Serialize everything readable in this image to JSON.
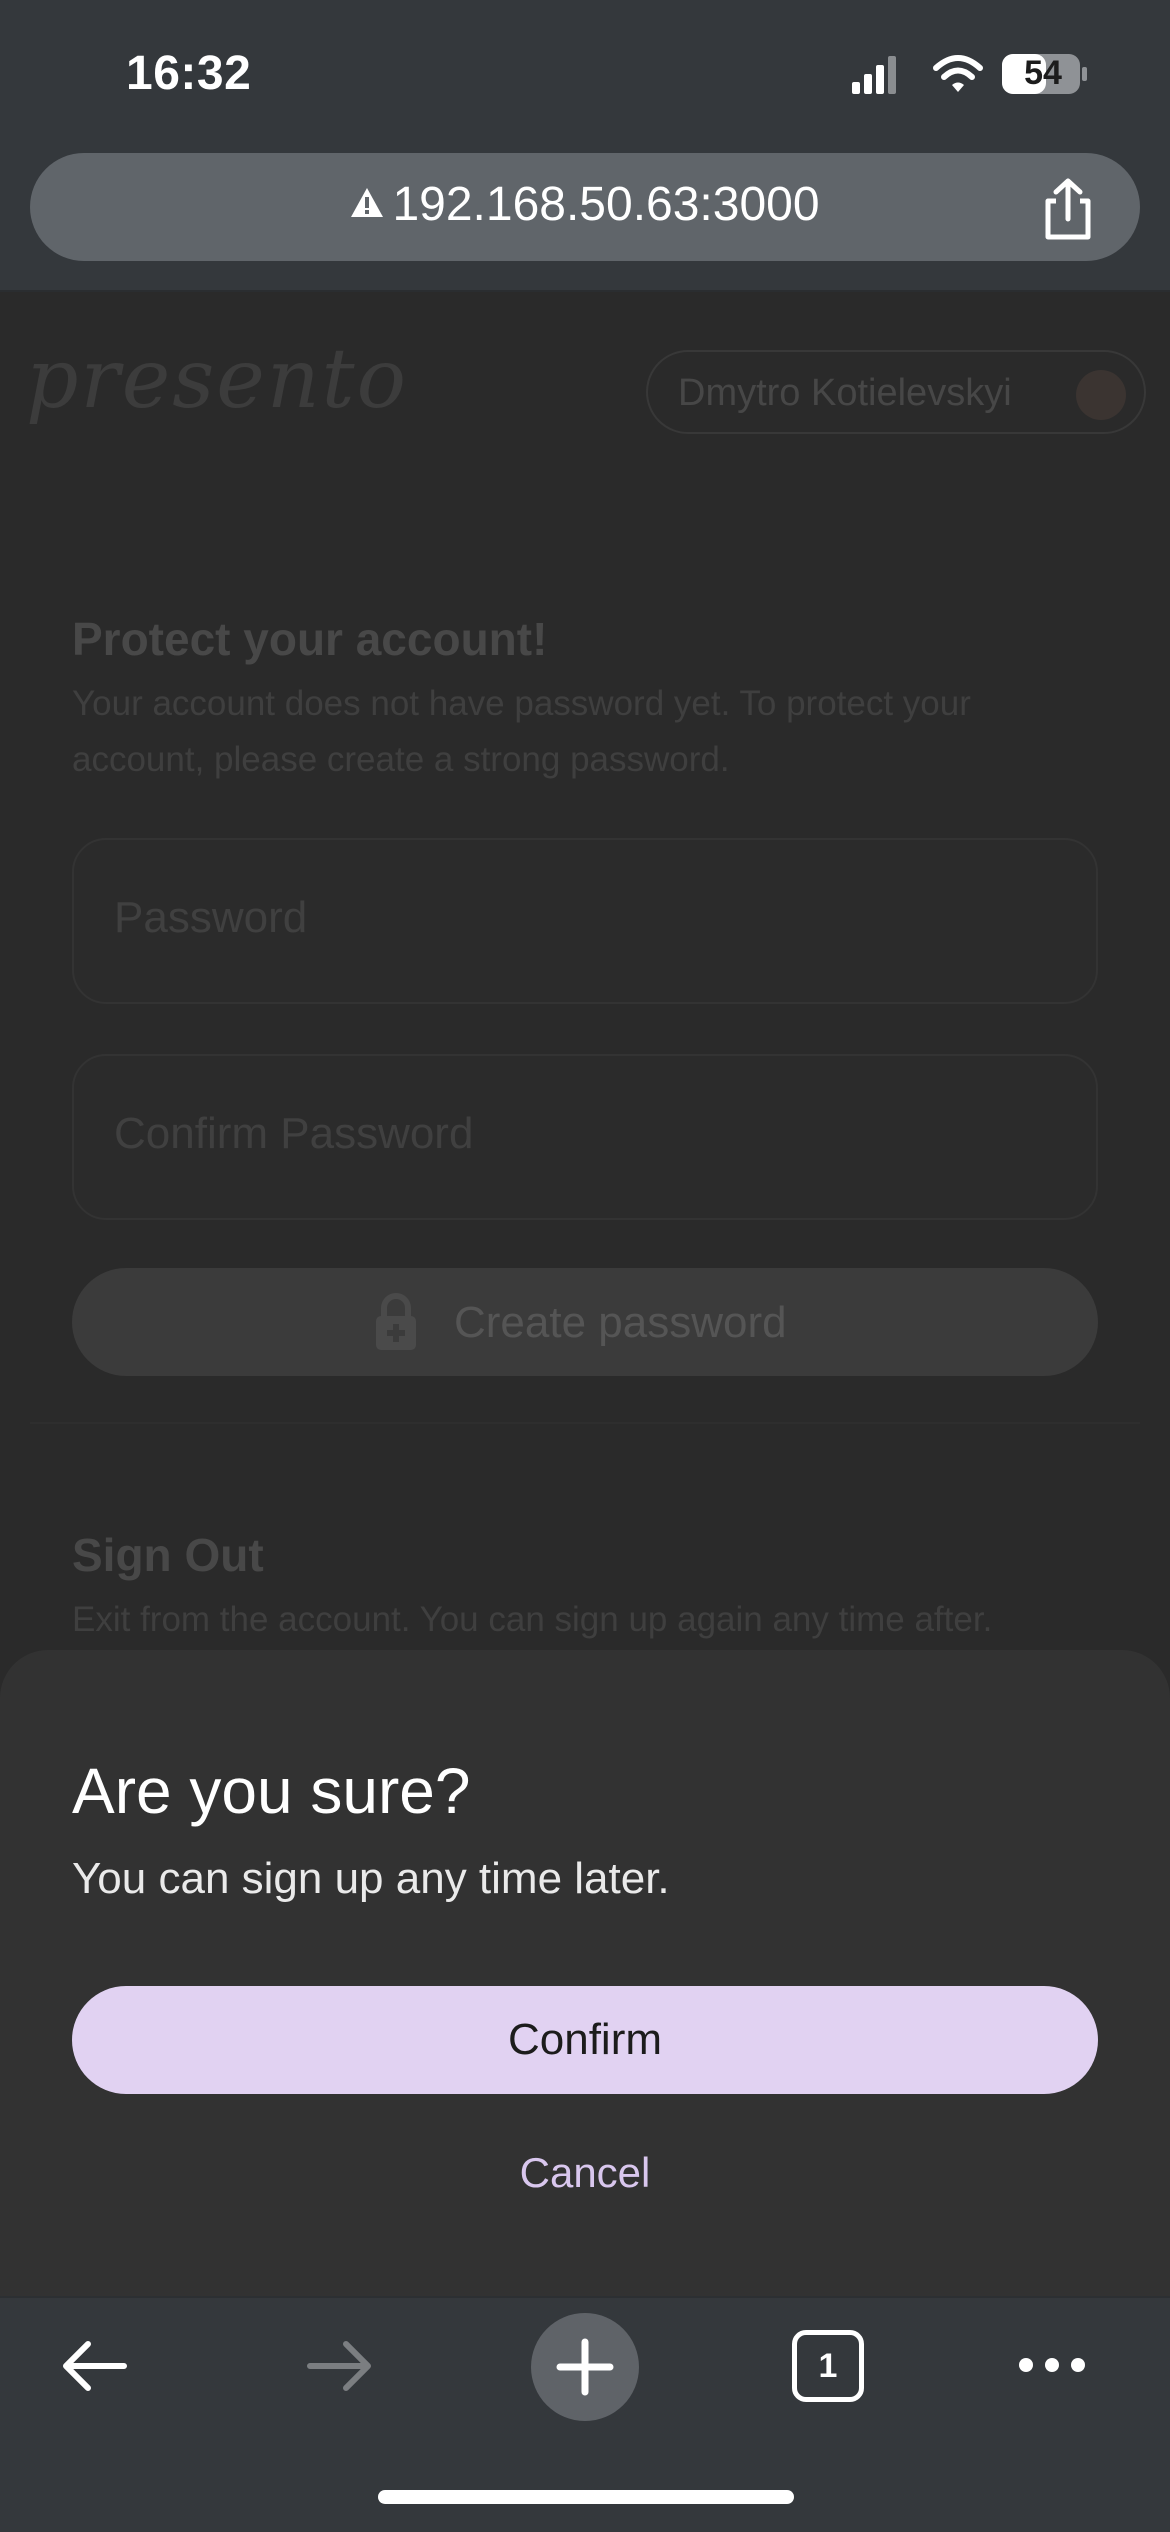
{
  "status_bar": {
    "time": "16:32",
    "battery": "54",
    "icons": [
      "cellular-signal-icon",
      "wifi-icon",
      "battery-icon"
    ]
  },
  "browser": {
    "url": "192.168.50.63:3000",
    "url_icon": "warning-icon",
    "share_icon": "share-icon"
  },
  "page": {
    "logo": "presento",
    "user_name": "Dmytro Kotielevskyi",
    "protect": {
      "title": "Protect your account!",
      "description": "Your account does not have password yet. To protect your account, please create a strong password.",
      "password_placeholder": "Password",
      "confirm_placeholder": "Confirm Password",
      "create_button": "Create password"
    },
    "signout": {
      "title": "Sign Out",
      "description": "Exit from the account. You can sign up again any time after."
    }
  },
  "sheet": {
    "title": "Are you sure?",
    "subtitle": "You can sign up any time later.",
    "confirm": "Confirm",
    "cancel": "Cancel"
  },
  "toolbar": {
    "tab_count": "1",
    "icons": [
      "back-arrow-icon",
      "forward-arrow-icon",
      "new-tab-icon",
      "tabs-icon",
      "more-icon"
    ]
  },
  "colors": {
    "accent": "#e1d2f2",
    "cancel_text": "#d9c7ee",
    "sheet_bg": "#323232",
    "chrome_bg": "#34383c"
  }
}
